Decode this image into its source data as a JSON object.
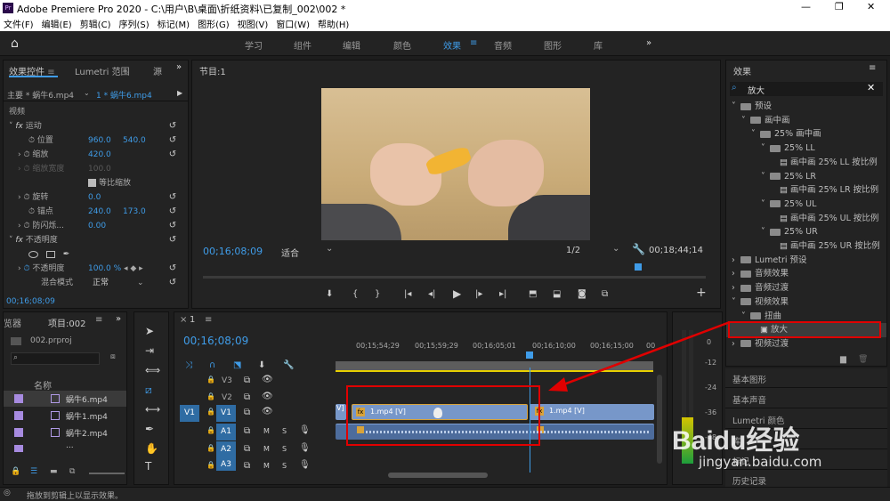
{
  "app": {
    "title": "Adobe Premiere Pro 2020 - C:\\用户\\B\\桌面\\折纸资料\\已复制_002\\002 *",
    "win_min": "—",
    "win_max": "❐",
    "win_close": "✕"
  },
  "menu": [
    "文件(F)",
    "编辑(E)",
    "剪辑(C)",
    "序列(S)",
    "标记(M)",
    "图形(G)",
    "视图(V)",
    "窗口(W)",
    "帮助(H)"
  ],
  "workspaces": [
    "学习",
    "组件",
    "编辑",
    "颜色",
    "效果",
    "音频",
    "图形",
    "库"
  ],
  "active_workspace": "效果",
  "effect_controls": {
    "tab": "效果控件",
    "tab2": "Lumetri 范围",
    "tab3": "源",
    "master": "主要 * 蜗牛6.mp4",
    "clip": "1 * 蜗牛6.mp4",
    "video": "视频",
    "motion": "运动",
    "position": "位置",
    "pos_x": "960.0",
    "pos_y": "540.0",
    "scale": "缩放",
    "scale_v": "420.0",
    "scale_w": "缩放宽度",
    "scale_w_v": "100.0",
    "uniform": "等比缩放",
    "rotation": "旋转",
    "rotation_v": "0.0",
    "anchor": "锚点",
    "anchor_x": "240.0",
    "anchor_y": "173.0",
    "antiflicker": "防闪烁...",
    "antiflicker_v": "0.00",
    "opacity_group": "不透明度",
    "opacity": "不透明度",
    "opacity_v": "100.0 %",
    "blend": "混合模式",
    "blend_v": "正常",
    "timecode": "00;16;08;09"
  },
  "program": {
    "title": "节目:1",
    "timecode": "00;16;08;09",
    "fit": "适合",
    "quality": "1/2",
    "duration": "00;18;44;14"
  },
  "project": {
    "tab0": "览器",
    "tab": "项目:002",
    "file": "002.prproj",
    "name_col": "名称",
    "items": [
      "蜗牛6.mp4",
      "蜗牛1.mp4",
      "蜗牛2.mp4",
      "..."
    ],
    "colors": [
      "#a78be0",
      "#a78be0",
      "#a78be0",
      "#a78be0"
    ]
  },
  "timeline": {
    "tab": "1",
    "timecode": "00;16;08;09",
    "ruler": [
      "00;15;54;29",
      "00;15;59;29",
      "00;16;05;01",
      "00;16;10;00",
      "00;16;15;00",
      "00"
    ],
    "tracks": [
      "V3",
      "V2",
      "V1",
      "A1",
      "A2",
      "A3"
    ],
    "src_v": "V1",
    "clip_v1": "1.mp4 [V]",
    "clip_v2": "1.mp4 [V]",
    "m": "M",
    "s": "S"
  },
  "meter": {
    "ticks": [
      "0",
      "-12",
      "-24",
      "-36",
      "-48"
    ]
  },
  "effects": {
    "title": "效果",
    "search": "放大",
    "tree": [
      {
        "label": "预设",
        "indent": 0,
        "type": "folder"
      },
      {
        "label": "画中画",
        "indent": 1,
        "type": "folder"
      },
      {
        "label": "25% 画中画",
        "indent": 2,
        "type": "folder"
      },
      {
        "label": "25% LL",
        "indent": 3,
        "type": "folder"
      },
      {
        "label": "画中画 25% LL 按比例",
        "indent": 4,
        "type": "item"
      },
      {
        "label": "25% LR",
        "indent": 3,
        "type": "folder"
      },
      {
        "label": "画中画 25% LR 按比例",
        "indent": 4,
        "type": "item"
      },
      {
        "label": "25% UL",
        "indent": 3,
        "type": "folder"
      },
      {
        "label": "画中画 25% UL 按比例",
        "indent": 4,
        "type": "item"
      },
      {
        "label": "25% UR",
        "indent": 3,
        "type": "folder"
      },
      {
        "label": "画中画 25% UR 按比例",
        "indent": 4,
        "type": "item"
      },
      {
        "label": "Lumetri 预设",
        "indent": 0,
        "type": "folder"
      },
      {
        "label": "音频效果",
        "indent": 0,
        "type": "folder"
      },
      {
        "label": "音频过渡",
        "indent": 0,
        "type": "folder"
      },
      {
        "label": "视频效果",
        "indent": 0,
        "type": "folder"
      },
      {
        "label": "扭曲",
        "indent": 1,
        "type": "folder"
      },
      {
        "label": "放大",
        "indent": 2,
        "type": "effect"
      },
      {
        "label": "视频过渡",
        "indent": 0,
        "type": "folder"
      }
    ],
    "panels": [
      "基本图形",
      "基本声音",
      "Lumetri 颜色",
      "库",
      "标记",
      "历史记录"
    ]
  },
  "status": "拖放到剪辑上以显示效果。",
  "watermark": {
    "text": "Baidu经验",
    "url": "jingyan.baidu.com"
  }
}
